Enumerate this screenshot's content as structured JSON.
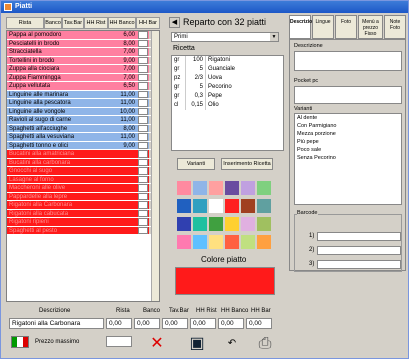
{
  "window": {
    "title": "Piatti"
  },
  "list_tabs": [
    "Rista",
    "Banco",
    "Tav.Bar",
    "HH Rist",
    "HH Banco",
    "HH Bar"
  ],
  "dishes": [
    {
      "name": "Pappa al pomodoro",
      "price": "6,00",
      "color": "pink"
    },
    {
      "name": "Pesciatelli in brodo",
      "price": "8,00",
      "color": "pink"
    },
    {
      "name": "Stracciatella",
      "price": "7,00",
      "color": "pink"
    },
    {
      "name": "Tortellini in brodo",
      "price": "9,00",
      "color": "pink"
    },
    {
      "name": "Zuppa alla ciociara",
      "price": "7,00",
      "color": "pink"
    },
    {
      "name": "Zuppa Fiammingga",
      "price": "7,00",
      "color": "pink"
    },
    {
      "name": "Zuppa vellutata",
      "price": "6,50",
      "color": "pink"
    },
    {
      "name": "Linguine alle marinara",
      "price": "11,00",
      "color": "blue"
    },
    {
      "name": "Linguine alla pescatora",
      "price": "11,00",
      "color": "blue"
    },
    {
      "name": "Linguine alle vongole",
      "price": "10,00",
      "color": "blue"
    },
    {
      "name": "Ravioli al sugo di carne",
      "price": "11,00",
      "color": "blue"
    },
    {
      "name": "Spaghetti all'acciughe",
      "price": "8,00",
      "color": "blue"
    },
    {
      "name": "Spaghetti alla vesuviana",
      "price": "11,00",
      "color": "blue"
    },
    {
      "name": "Spaghetti tonno e olici",
      "price": "9,00",
      "color": "blue"
    },
    {
      "name": "Bucatini alla amatriciana",
      "price": "",
      "color": "red"
    },
    {
      "name": "Bucatini alla carbonara",
      "price": "",
      "color": "red"
    },
    {
      "name": "Gnocchi al sugo",
      "price": "",
      "color": "red"
    },
    {
      "name": "Lasagne al forno",
      "price": "",
      "color": "red"
    },
    {
      "name": "Maccheroni alle olive",
      "price": "",
      "color": "red"
    },
    {
      "name": "Pappardelle alla lepre",
      "price": "",
      "color": "red"
    },
    {
      "name": "Rigatoni alla Carbonara",
      "price": "",
      "color": "red"
    },
    {
      "name": "Rigatoni alla cabucata",
      "price": "",
      "color": "red"
    },
    {
      "name": "Rigatoni ripieni",
      "price": "",
      "color": "red"
    },
    {
      "name": "Spaghetti al pesto",
      "price": "",
      "color": "red"
    }
  ],
  "reparto": {
    "title": "Reparto con 32 piatti",
    "selected": "Primi"
  },
  "ricetta": {
    "label": "Ricetta",
    "rows": [
      {
        "u": "gr",
        "q": "100",
        "n": "Rigatoni"
      },
      {
        "u": "gr",
        "q": "5",
        "n": "Guanciale"
      },
      {
        "u": "pz",
        "q": "2/3",
        "n": "Uova"
      },
      {
        "u": "gr",
        "q": "5",
        "n": "Pecorino"
      },
      {
        "u": "gr",
        "q": "0,3",
        "n": "Pepe"
      },
      {
        "u": "cl",
        "q": "0,15",
        "n": "Olio"
      }
    ],
    "btn_varianti": "Varianti",
    "btn_inserimento": "Inserimento Ricetta"
  },
  "palette": [
    "#ff8aa0",
    "#8fb5e8",
    "#ffa0a0",
    "#6a4ca0",
    "#c0a0e0",
    "#7fd07f",
    "#2060c0",
    "#30a0c0",
    "#ffffff",
    "#ff2020",
    "#a04020",
    "#60a0a0",
    "#3040b0",
    "#20c0a0",
    "#40a040",
    "#ffd030",
    "#e0b0e0",
    "#a0c060",
    "#ff7ab0",
    "#60c0ff",
    "#ffe080",
    "#ff6040",
    "#c0e080",
    "#ffa040"
  ],
  "colori_label": "Colore piatto",
  "right_tabs": [
    "Descrizioni",
    "Lingue",
    "Foto",
    "Menù a prezzo Fisso",
    "Note Foto"
  ],
  "right": {
    "descrizione": "Descrizione",
    "pocket": "Pocket pc",
    "varianti_label": "Varianti",
    "varianti": [
      "Al dente",
      "Con Parmigiano",
      "Mezza porzione",
      "Più pepe",
      "Poco sale",
      "Senza Pecorino"
    ],
    "barcode_label": "Barcode",
    "barcode_rows": [
      "1)",
      "2)",
      "3)"
    ]
  },
  "bottom": {
    "headers": [
      "Descrizione",
      "Rista",
      "Banco",
      "Tav.Bar",
      "HH Rist",
      "HH Banco",
      "HH Bar"
    ],
    "values": [
      "Rigatoni alla Carbonara",
      "0,00",
      "0,00",
      "0,00",
      "0,00",
      "0,00",
      "0,00"
    ],
    "prezzo_label": "Prezzo massimo"
  }
}
